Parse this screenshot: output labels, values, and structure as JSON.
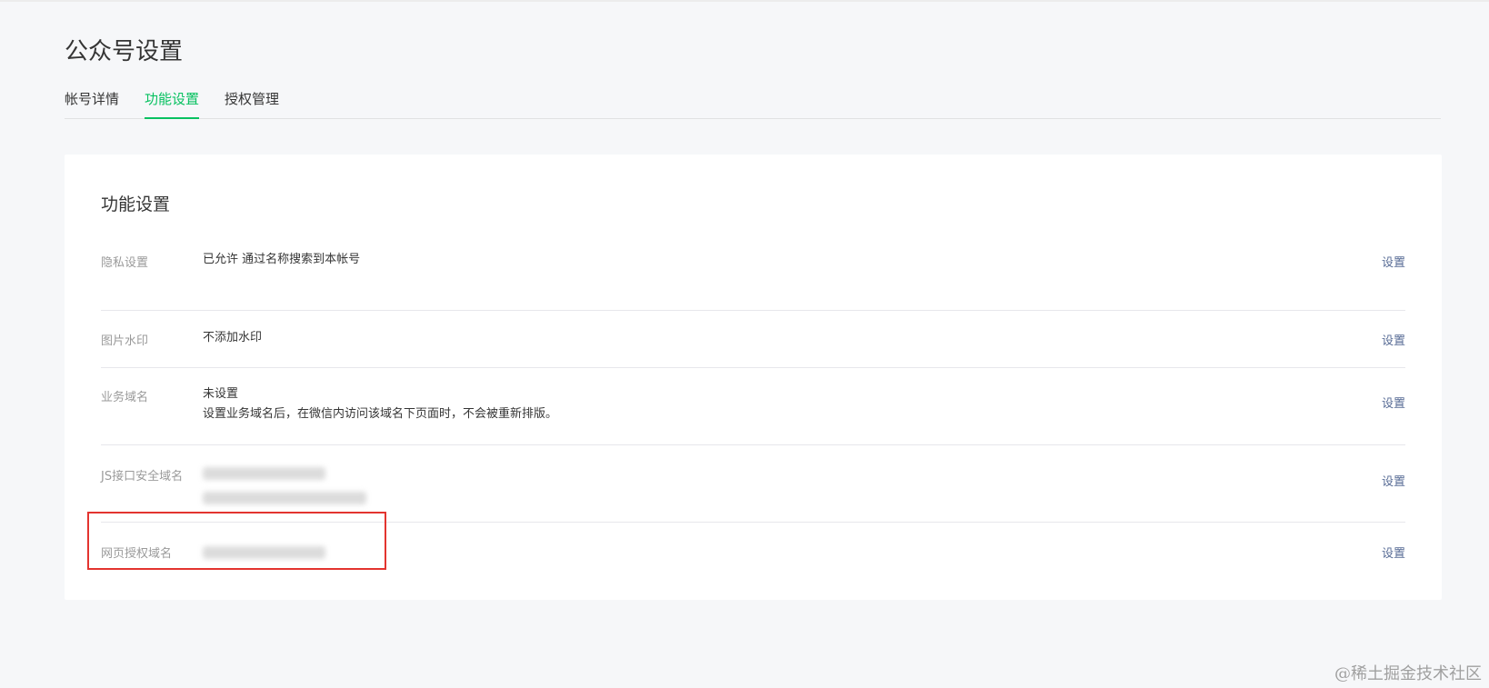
{
  "page_title": "公众号设置",
  "tabs": [
    {
      "label": "帐号详情",
      "active": false
    },
    {
      "label": "功能设置",
      "active": true
    },
    {
      "label": "授权管理",
      "active": false
    }
  ],
  "section_title": "功能设置",
  "rows": [
    {
      "label": "隐私设置",
      "value_lines": [
        "已允许 通过名称搜索到本帐号"
      ],
      "action": "设置"
    },
    {
      "label": "图片水印",
      "value_lines": [
        "不添加水印"
      ],
      "action": "设置"
    },
    {
      "label": "业务域名",
      "value_lines": [
        "未设置",
        "设置业务域名后，在微信内访问该域名下页面时，不会被重新排版。"
      ],
      "action": "设置"
    },
    {
      "label": "JS接口安全域名",
      "value_lines": [],
      "action": "设置"
    },
    {
      "label": "网页授权域名",
      "value_lines": [],
      "action": "设置"
    }
  ],
  "watermark": "@稀土掘金技术社区",
  "colors": {
    "accent": "#07c160",
    "link": "#576b95",
    "highlight": "#e3342f",
    "background": "#f6f7f9"
  }
}
